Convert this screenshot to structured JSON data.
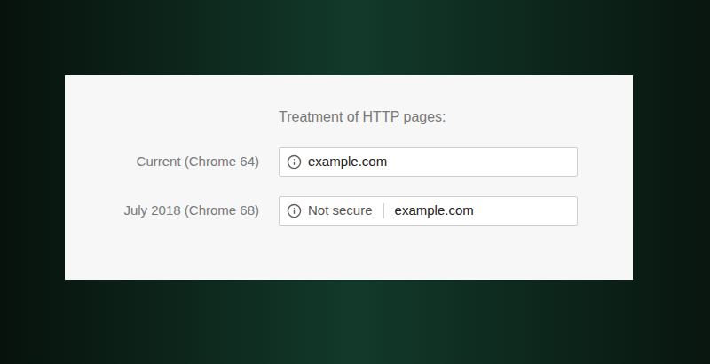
{
  "card": {
    "heading": "Treatment of HTTP pages:"
  },
  "rows": [
    {
      "label": "Current (Chrome 64)",
      "kind": "plain",
      "badge": "",
      "url": "example.com"
    },
    {
      "label": "July 2018 (Chrome 68)",
      "kind": "warning",
      "badge": "Not secure",
      "url": "example.com"
    }
  ]
}
